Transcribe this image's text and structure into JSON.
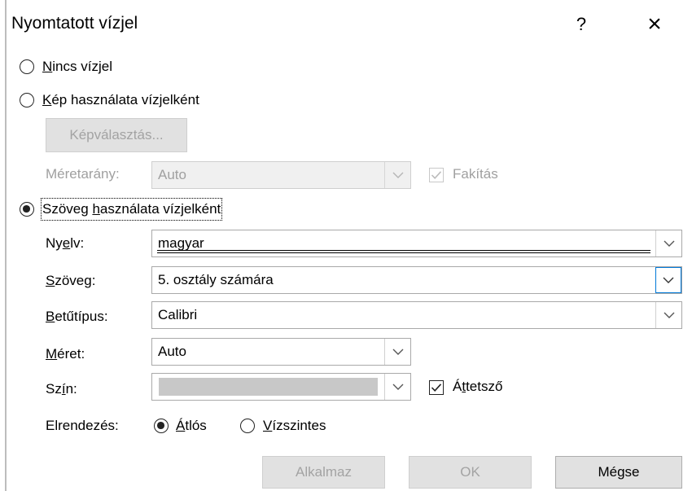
{
  "dialog": {
    "title": "Nyomtatott vízjel",
    "help_label": "?",
    "close_label": "×"
  },
  "no_watermark": {
    "ul": "N",
    "rest": "incs vízjel",
    "selected": false
  },
  "picture_watermark": {
    "ul": "K",
    "rest": "ép használata vízjelként",
    "selected": false,
    "select_picture_button": "Képválasztás...",
    "scale_label": "Méretarány:",
    "scale_value": "Auto",
    "washout_label": "Fakítás",
    "washout_checked": true
  },
  "text_watermark": {
    "pre": "Szöveg ",
    "ul": "h",
    "rest": "asználata vízjelként",
    "selected": true,
    "language": {
      "pre": "Ny",
      "ul": "e",
      "rest": "lv:",
      "value": "magyar"
    },
    "text": {
      "pre": "",
      "ul": "S",
      "rest": "zöveg:",
      "value": "5. osztály számára"
    },
    "font": {
      "pre": "",
      "ul": "B",
      "rest": "etűtípus:",
      "value": "Calibri"
    },
    "size": {
      "pre": "",
      "ul": "M",
      "rest": "éret:",
      "value": "Auto"
    },
    "color": {
      "pre": "Sz",
      "ul": "í",
      "rest": "n:",
      "swatch": "#c8c8c8"
    },
    "semitransparent": {
      "pre": "Á",
      "ul": "t",
      "rest": "tetsző",
      "checked": true
    },
    "layout_label": "Elrendezés:",
    "diagonal": {
      "ul": "Á",
      "rest": "tlós",
      "selected": true
    },
    "horizontal": {
      "ul": "V",
      "rest": "ízszintes",
      "selected": false
    }
  },
  "buttons": {
    "apply": "Alkalmaz",
    "ok": "OK",
    "cancel": "Mégse"
  }
}
